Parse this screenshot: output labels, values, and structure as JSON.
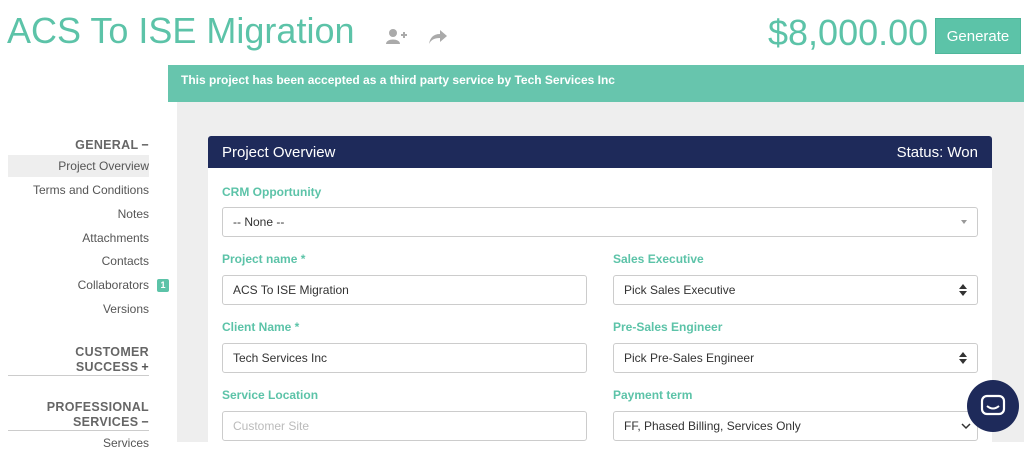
{
  "header": {
    "title": "ACS To ISE Migration",
    "amount": "$8,000.00",
    "generate_label": "Generate",
    "icons": [
      "add-user-icon",
      "share-icon"
    ]
  },
  "banner": {
    "text": "This project has been accepted as a third party service by Tech Services Inc"
  },
  "sidebar": {
    "sections": [
      {
        "title": "GENERAL",
        "toggle": "−"
      },
      {
        "title_line1": "CUSTOMER",
        "title_line2": "SUCCESS",
        "toggle": "+"
      },
      {
        "title_line1": "PROFESSIONAL",
        "title_line2": "SERVICES",
        "toggle": "−"
      }
    ],
    "items": [
      {
        "label": "Project Overview",
        "active": true
      },
      {
        "label": "Terms and Conditions"
      },
      {
        "label": "Notes"
      },
      {
        "label": "Attachments"
      },
      {
        "label": "Contacts"
      },
      {
        "label": "Collaborators",
        "badge": "1"
      },
      {
        "label": "Versions"
      },
      {
        "label": "Services"
      }
    ]
  },
  "panel": {
    "title": "Project Overview",
    "status": "Status: Won",
    "fields": {
      "crm_label": "CRM Opportunity",
      "crm_value": "-- None --",
      "project_name_label": "Project name *",
      "project_name_value": "ACS To ISE Migration",
      "sales_exec_label": "Sales Executive",
      "sales_exec_value": "Pick Sales Executive",
      "client_name_label": "Client Name *",
      "client_name_value": "Tech Services Inc",
      "presales_label": "Pre-Sales Engineer",
      "presales_value": "Pick Pre-Sales Engineer",
      "service_location_label": "Service Location",
      "service_location_placeholder": "Customer Site",
      "payment_term_label": "Payment term",
      "payment_term_value": "FF, Phased Billing, Services Only"
    }
  },
  "colors": {
    "accent": "#5cc3a8",
    "banner": "#67c5ad",
    "panel_header": "#1e2a5a",
    "content_bg": "#eeeeee"
  }
}
